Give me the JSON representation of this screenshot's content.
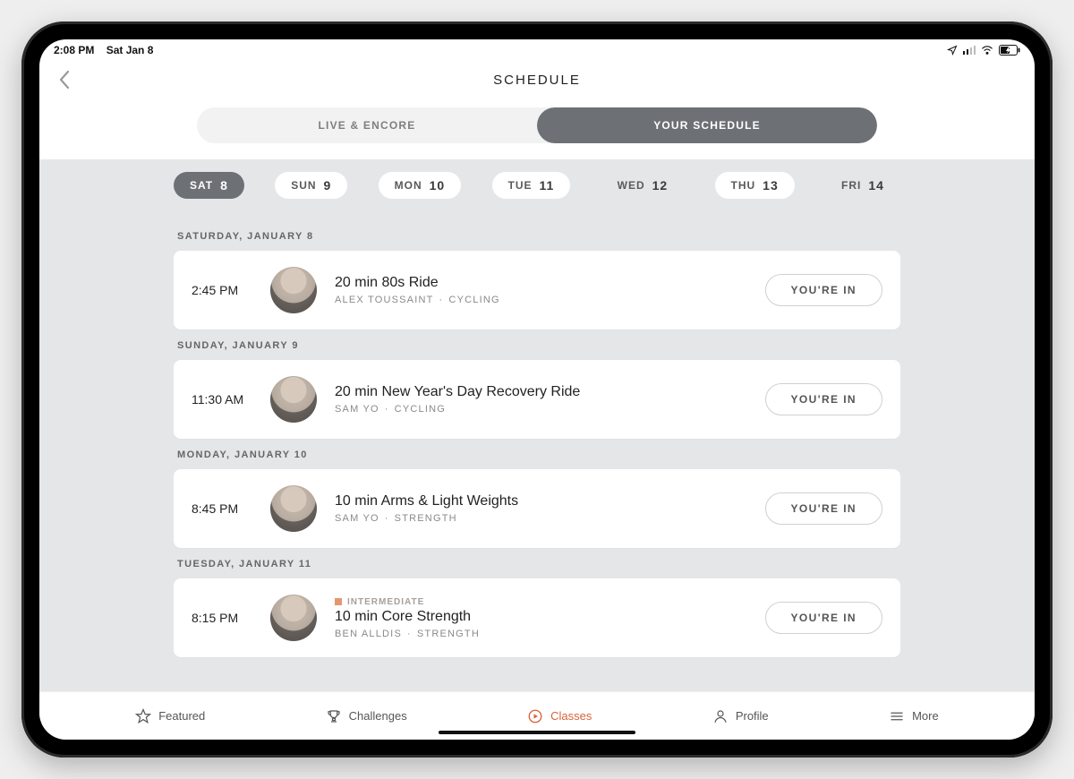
{
  "statusbar": {
    "time": "2:08 PM",
    "date": "Sat Jan 8"
  },
  "header": {
    "title": "SCHEDULE"
  },
  "segment": {
    "left": "LIVE & ENCORE",
    "right": "YOUR SCHEDULE",
    "active": "right"
  },
  "dates": [
    {
      "dow": "SAT",
      "num": "8",
      "style": "selected"
    },
    {
      "dow": "SUN",
      "num": "9",
      "style": "filled"
    },
    {
      "dow": "MON",
      "num": "10",
      "style": "filled"
    },
    {
      "dow": "TUE",
      "num": "11",
      "style": "filled"
    },
    {
      "dow": "WED",
      "num": "12",
      "style": "plain"
    },
    {
      "dow": "THU",
      "num": "13",
      "style": "filled"
    },
    {
      "dow": "FRI",
      "num": "14",
      "style": "plain"
    }
  ],
  "groups": [
    {
      "label": "SATURDAY, JANUARY 8",
      "cards": [
        {
          "time": "2:45 PM",
          "title": "20 min 80s Ride",
          "instructor": "ALEX TOUSSAINT",
          "category": "CYCLING",
          "status": "YOU'RE IN"
        }
      ]
    },
    {
      "label": "SUNDAY, JANUARY 9",
      "cards": [
        {
          "time": "11:30 AM",
          "title": "20 min New Year's Day Recovery Ride",
          "instructor": "SAM YO",
          "category": "CYCLING",
          "status": "YOU'RE IN"
        }
      ]
    },
    {
      "label": "MONDAY, JANUARY 10",
      "cards": [
        {
          "time": "8:45 PM",
          "title": "10 min Arms & Light Weights",
          "instructor": "SAM YO",
          "category": "STRENGTH",
          "status": "YOU'RE IN"
        }
      ]
    },
    {
      "label": "TUESDAY, JANUARY 11",
      "cards": [
        {
          "time": "8:15 PM",
          "level": "INTERMEDIATE",
          "title": "10 min Core Strength",
          "instructor": "BEN ALLDIS",
          "category": "STRENGTH",
          "status": "YOU'RE IN"
        }
      ]
    }
  ],
  "tabs": {
    "featured": "Featured",
    "challenges": "Challenges",
    "classes": "Classes",
    "profile": "Profile",
    "more": "More",
    "active": "classes"
  }
}
